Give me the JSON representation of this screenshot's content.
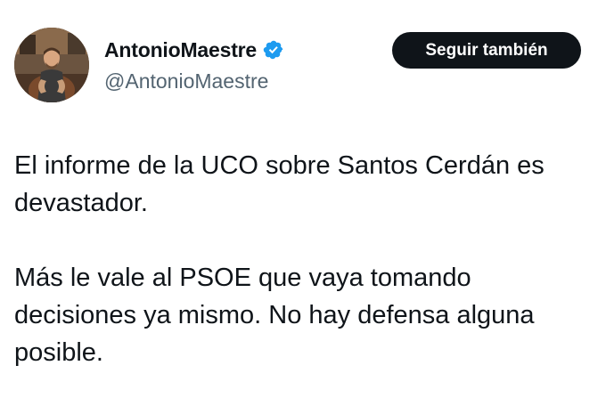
{
  "author": {
    "display_name": "AntonioMaestre",
    "handle": "@AntonioMaestre",
    "verified": true,
    "verified_badge_color": "#1d9bf0",
    "avatar_icon": "profile-photo"
  },
  "follow_button": {
    "label": "Seguir también",
    "background": "#0f1419",
    "text_color": "#ffffff"
  },
  "tweet": {
    "paragraphs": [
      "El informe de la UCO sobre Santos Cerdán es devastador.",
      "Más le vale al PSOE que vaya tomando decisiones ya mismo. No hay defensa alguna posible."
    ]
  },
  "colors": {
    "text_primary": "#0f1419",
    "text_secondary": "#536471",
    "background": "#ffffff"
  }
}
